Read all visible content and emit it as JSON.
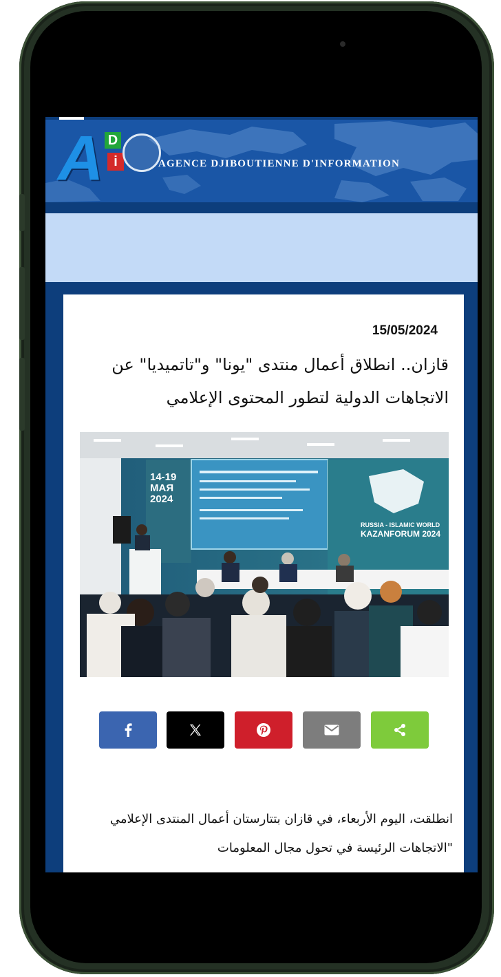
{
  "site": {
    "logo_letter": "A",
    "logo_d": "D",
    "logo_i": "i",
    "agency_name": "AGENCE DJIBOUTIENNE D'INFORMATION"
  },
  "article": {
    "date": "15/05/2024",
    "title": "قازان.. انطلاق أعمال منتدى \"يونا\" و\"تاتميديا\" عن الاتجاهات الدولية لتطور المحتوى الإعلامي",
    "photo": {
      "screen_dates": "14-19\nМАЯ\n2024",
      "forum_sign": "RUSSIA - ISLAMIC WORLD\nKAZANFORUM 2024"
    },
    "body": "انطلقت، اليوم الأربعاء، في قازان بتتارستان أعمال المنتدى الإعلامي \"الاتجاهات الرئيسة في تحول مجال المعلومات"
  },
  "share": [
    {
      "name": "facebook",
      "icon": "facebook-icon",
      "color": "#3b65b0"
    },
    {
      "name": "x",
      "icon": "x-icon",
      "color": "#000000"
    },
    {
      "name": "pinterest",
      "icon": "pinterest-icon",
      "color": "#cf1f2b"
    },
    {
      "name": "email",
      "icon": "email-icon",
      "color": "#7d7d7d"
    },
    {
      "name": "share",
      "icon": "share-icon",
      "color": "#7ecb3b"
    }
  ],
  "colors": {
    "banner": "#1a56a6",
    "page_background": "#0d3e7c",
    "pale_band": "#c3daf7"
  }
}
